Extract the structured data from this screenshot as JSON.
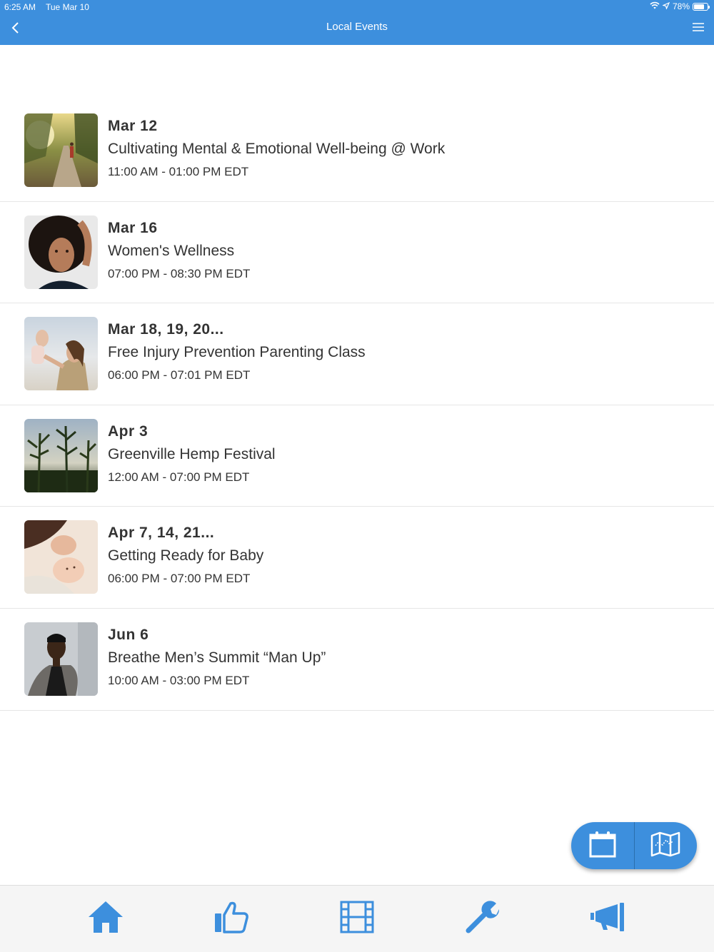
{
  "status_bar": {
    "time": "6:25 AM",
    "date": "Tue Mar 10",
    "battery": "78%",
    "battery_level": 0.78
  },
  "header": {
    "title": "Local Events",
    "back_icon": "chevron-left-icon",
    "menu_icon": "hamburger-icon"
  },
  "colors": {
    "brand": "#3d8fdd",
    "text": "#333333",
    "divider": "#e6e6e6"
  },
  "events": [
    {
      "date": "Mar 12",
      "title": "Cultivating Mental & Emotional Well-being @ Work",
      "time": "11:00 AM - 01:00 PM EDT"
    },
    {
      "date": "Mar 16",
      "title": "Women's Wellness",
      "time": "07:00 PM - 08:30 PM EDT"
    },
    {
      "date": "Mar 18, 19, 20...",
      "title": "Free Injury Prevention Parenting Class",
      "time": "06:00 PM - 07:01 PM EDT"
    },
    {
      "date": "Apr 3",
      "title": "Greenville Hemp Festival",
      "time": "12:00 AM - 07:00 PM EDT"
    },
    {
      "date": "Apr 7, 14, 21...",
      "title": "Getting Ready for Baby",
      "time": "06:00 PM - 07:00 PM EDT"
    },
    {
      "date": "Jun 6",
      "title": "Breathe Men’s Summit “Man Up”",
      "time": "10:00 AM - 03:00 PM EDT"
    }
  ],
  "fab": {
    "left_icon": "calendar-icon",
    "right_icon": "map-icon"
  },
  "tabs": [
    {
      "icon": "home-icon"
    },
    {
      "icon": "thumbs-up-icon"
    },
    {
      "icon": "film-icon"
    },
    {
      "icon": "wrench-icon"
    },
    {
      "icon": "megaphone-icon"
    }
  ]
}
